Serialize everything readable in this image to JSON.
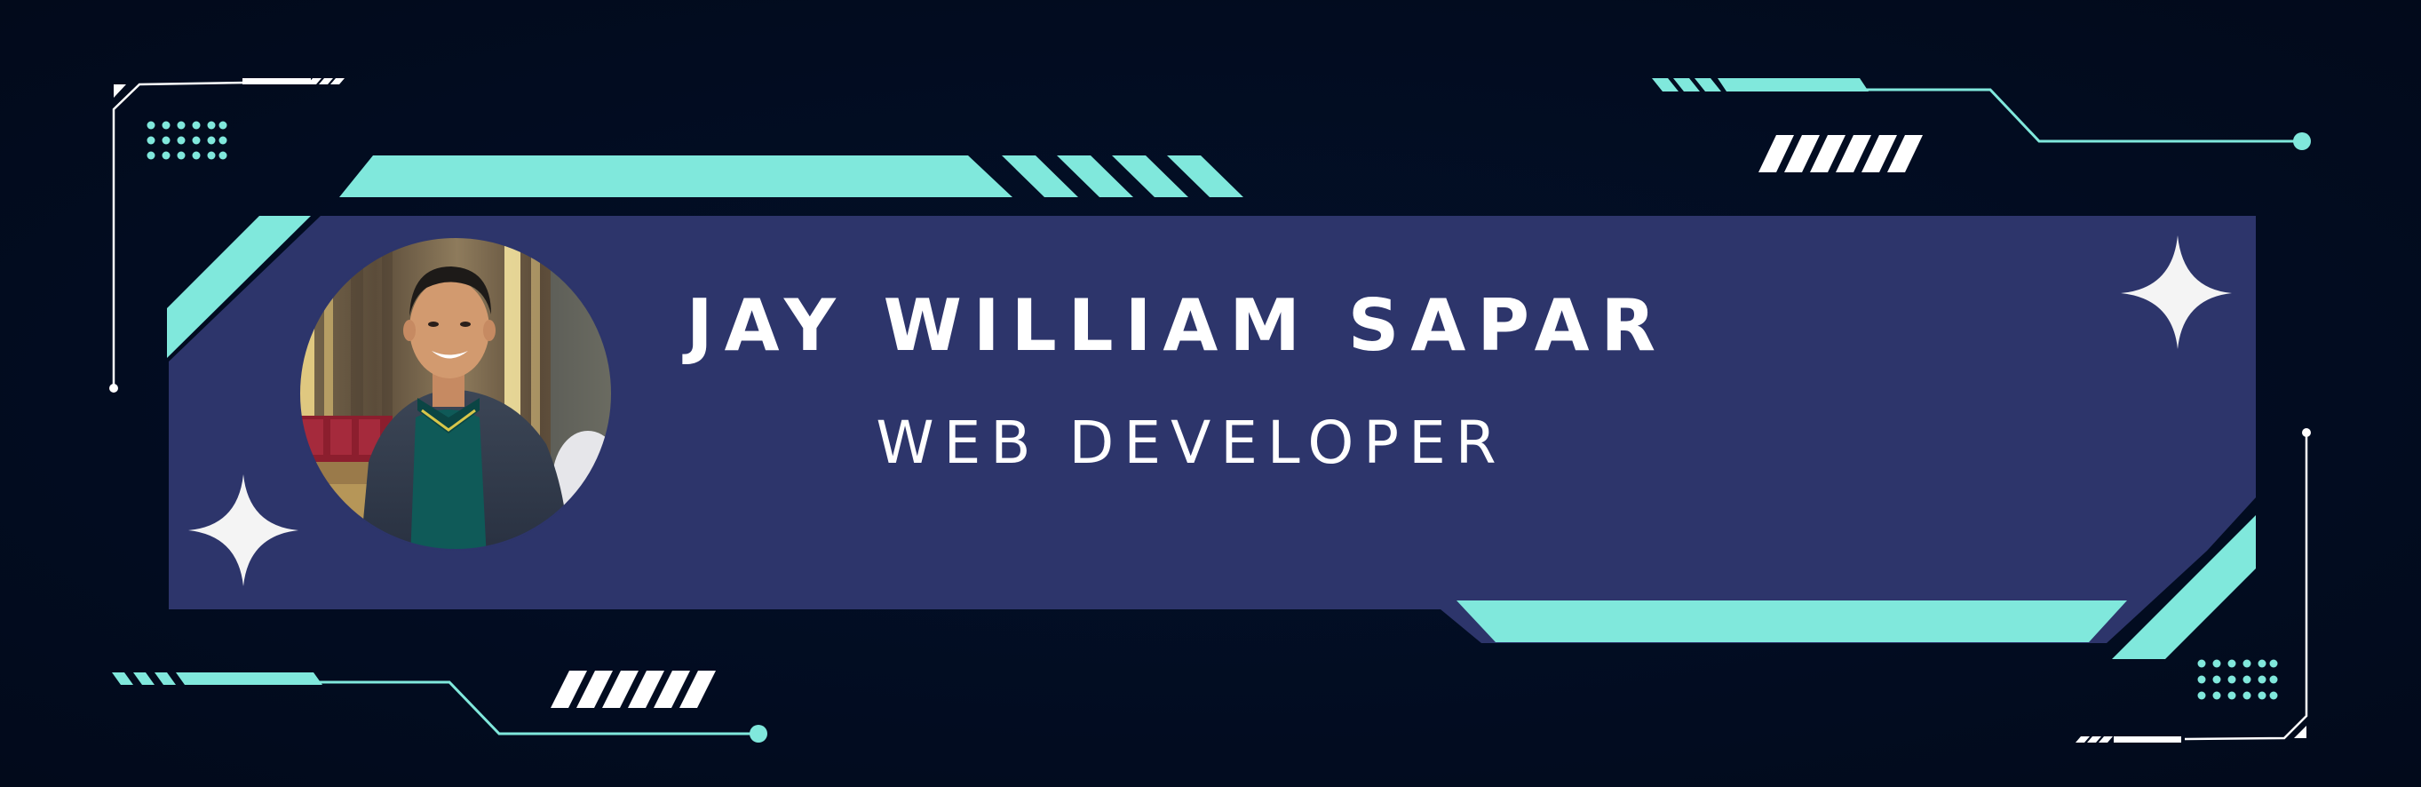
{
  "banner": {
    "name": "JAY WILLIAM SAPAR",
    "role": "WEB DEVELOPER"
  },
  "photo": {
    "alt": "Portrait photo of a smiling man in a dark green polo shirt and grey jacket"
  },
  "colors": {
    "background": "#020c1f",
    "panel": "#2d356b",
    "accent": "#80e8dc",
    "text": "#ffffff"
  },
  "icons": [
    "sparkle-icon",
    "dot-grid-icon",
    "slash-stripes-icon",
    "circuit-line-icon"
  ]
}
